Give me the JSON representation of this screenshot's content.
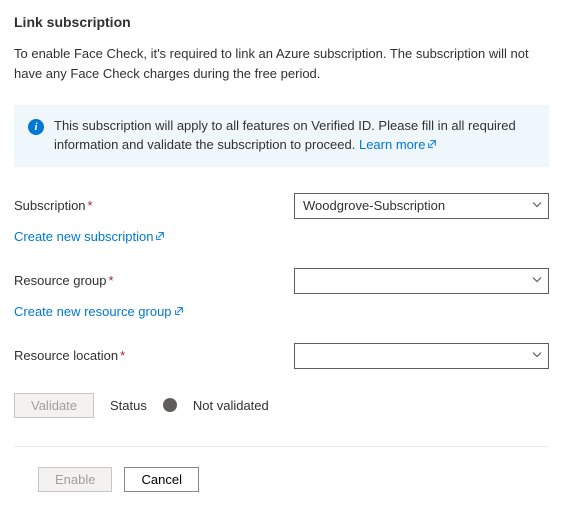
{
  "title": "Link subscription",
  "intro": "To enable Face Check, it's required to link an Azure subscription. The subscription will not have any Face Check charges during the free period.",
  "info": {
    "text": "This subscription will apply to all features on Verified ID. Please fill in all required information and validate the subscription to proceed. ",
    "learn_more": "Learn more"
  },
  "fields": {
    "subscription": {
      "label": "Subscription",
      "value": "Woodgrove-Subscription",
      "create_link": "Create new subscription"
    },
    "resource_group": {
      "label": "Resource group",
      "value": "",
      "create_link": "Create new resource group"
    },
    "resource_location": {
      "label": "Resource location",
      "value": ""
    }
  },
  "validate": {
    "button": "Validate",
    "status_label": "Status",
    "status_value": "Not validated"
  },
  "footer": {
    "enable": "Enable",
    "cancel": "Cancel"
  }
}
